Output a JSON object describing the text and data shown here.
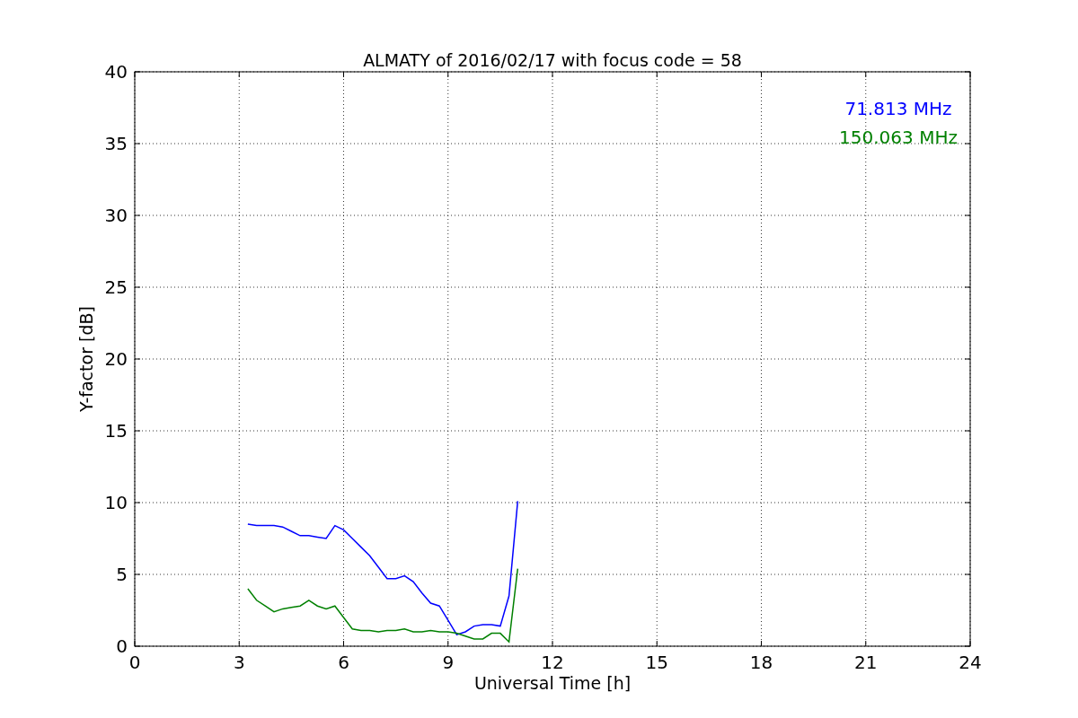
{
  "figure": {
    "chart_data": {
      "type": "line",
      "title": "ALMATY of 2016/02/17 with focus code = 58",
      "xlabel": "Universal Time [h]",
      "ylabel": "Y-factor [dB]",
      "x": [
        3.25,
        3.5,
        3.75,
        4.0,
        4.25,
        4.5,
        4.75,
        5.0,
        5.25,
        5.5,
        5.75,
        6.0,
        6.25,
        6.5,
        6.75,
        7.0,
        7.25,
        7.5,
        7.75,
        8.0,
        8.25,
        8.5,
        8.75,
        9.0,
        9.25,
        9.5,
        9.75,
        10.0,
        10.25,
        10.5,
        10.75,
        11.0
      ],
      "series": [
        {
          "name": "71.813 MHz",
          "color": "#0000ff",
          "values": [
            8.5,
            8.4,
            8.4,
            8.4,
            8.3,
            8.0,
            7.7,
            7.7,
            7.6,
            7.5,
            8.4,
            8.1,
            7.5,
            6.9,
            6.3,
            5.5,
            4.7,
            4.7,
            4.9,
            4.5,
            3.7,
            3.0,
            2.8,
            1.8,
            0.8,
            1.0,
            1.4,
            1.5,
            1.5,
            1.4,
            3.5,
            10.1
          ]
        },
        {
          "name": "150.063 MHz",
          "color": "#008000",
          "values": [
            4.0,
            3.2,
            2.8,
            2.4,
            2.6,
            2.7,
            2.8,
            3.2,
            2.8,
            2.6,
            2.8,
            2.0,
            1.2,
            1.1,
            1.1,
            1.0,
            1.1,
            1.1,
            1.2,
            1.0,
            1.0,
            1.1,
            1.0,
            1.0,
            0.9,
            0.7,
            0.5,
            0.5,
            0.9,
            0.9,
            0.3,
            5.4
          ]
        }
      ],
      "xlim": [
        0,
        24
      ],
      "ylim": [
        0,
        40
      ],
      "xticks": [
        0,
        3,
        6,
        9,
        12,
        15,
        18,
        21,
        24
      ],
      "yticks": [
        0,
        5,
        10,
        15,
        20,
        25,
        30,
        35,
        40
      ],
      "grid": true
    }
  }
}
